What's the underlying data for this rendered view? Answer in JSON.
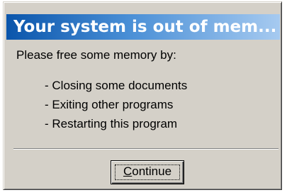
{
  "dialog": {
    "title": "Your system is out of mem...",
    "intro": "Please free some memory by:",
    "items": [
      "- Closing some documents",
      "- Exiting other programs",
      "- Restarting this program"
    ],
    "continue_button": {
      "accel": "C",
      "rest": "ontinue"
    }
  },
  "colors": {
    "dialog_face": "#d4d0c8",
    "title_gradient_start": "#0a55ab",
    "title_gradient_end": "#a6caf0",
    "title_text": "#ffffff"
  }
}
